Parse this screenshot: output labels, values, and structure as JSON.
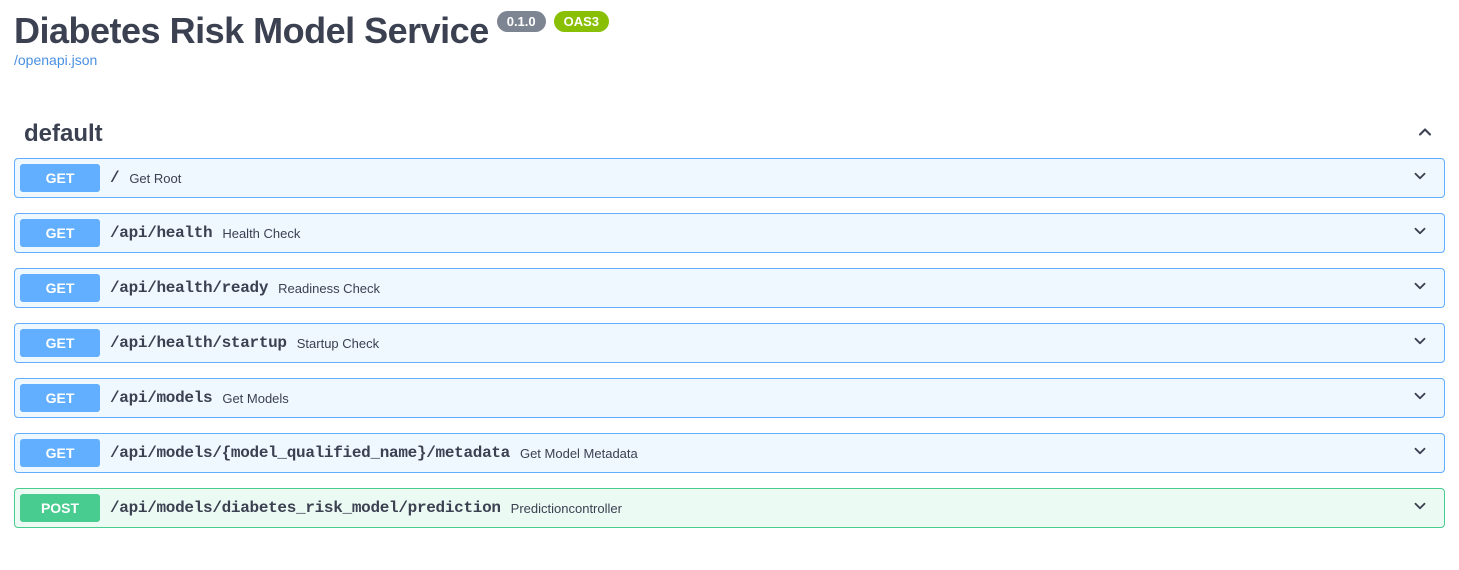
{
  "header": {
    "title": "Diabetes Risk Model Service",
    "version": "0.1.0",
    "oas": "OAS3",
    "spec_link": "/openapi.json"
  },
  "tag": {
    "name": "default"
  },
  "operations": [
    {
      "method": "GET",
      "method_class": "get",
      "path": "/",
      "summary": "Get Root"
    },
    {
      "method": "GET",
      "method_class": "get",
      "path": "/api/health",
      "summary": "Health Check"
    },
    {
      "method": "GET",
      "method_class": "get",
      "path": "/api/health/ready",
      "summary": "Readiness Check"
    },
    {
      "method": "GET",
      "method_class": "get",
      "path": "/api/health/startup",
      "summary": "Startup Check"
    },
    {
      "method": "GET",
      "method_class": "get",
      "path": "/api/models",
      "summary": "Get Models"
    },
    {
      "method": "GET",
      "method_class": "get",
      "path": "/api/models/{model_qualified_name}/metadata",
      "summary": "Get Model Metadata"
    },
    {
      "method": "POST",
      "method_class": "post",
      "path": "/api/models/diabetes_risk_model/prediction",
      "summary": "Predictioncontroller"
    }
  ]
}
